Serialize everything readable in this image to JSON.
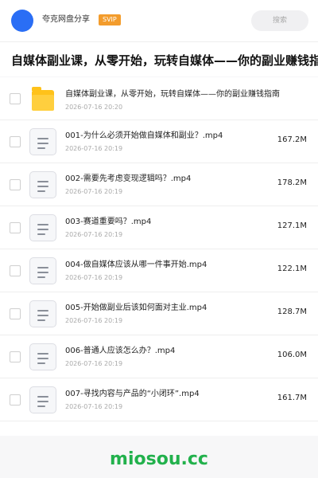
{
  "header": {
    "app_title": "夸克网盘分享",
    "badge": "SVIP",
    "search_placeholder": "搜索"
  },
  "page_title": "自媒体副业课，从零开始，玩转自媒体——你的副业赚钱指",
  "folder": {
    "name": "自媒体副业课，从零开始，玩转自媒体——你的副业赚钱指南",
    "date": "2026-07-16 20:20"
  },
  "files": [
    {
      "name": "001-为什么必须开始做自媒体和副业？.mp4",
      "date": "2026-07-16 20:19",
      "size": "167.2M"
    },
    {
      "name": "002-需要先考虑变现逻辑吗？.mp4",
      "date": "2026-07-16 20:19",
      "size": "178.2M"
    },
    {
      "name": "003-赛道重要吗？.mp4",
      "date": "2026-07-16 20:19",
      "size": "127.1M"
    },
    {
      "name": "004-做自媒体应该从哪一件事开始.mp4",
      "date": "2026-07-16 20:19",
      "size": "122.1M"
    },
    {
      "name": "005-开始做副业后该如何面对主业.mp4",
      "date": "2026-07-16 20:19",
      "size": "128.7M"
    },
    {
      "name": "006-普通人应该怎么办？.mp4",
      "date": "2026-07-16 20:19",
      "size": "106.0M"
    },
    {
      "name": "007-寻找内容与产品的“小闭环”.mp4",
      "date": "2026-07-16 20:19",
      "size": "161.7M"
    }
  ],
  "watermark": "miosou.cc",
  "colors": {
    "avatar": "#2a6ef5",
    "badge": "#f39c2c",
    "folder": "#ffc21a",
    "watermark": "#22b14c"
  },
  "icons": {
    "folder": "folder-icon",
    "file": "video-file-icon",
    "avatar": "avatar"
  }
}
